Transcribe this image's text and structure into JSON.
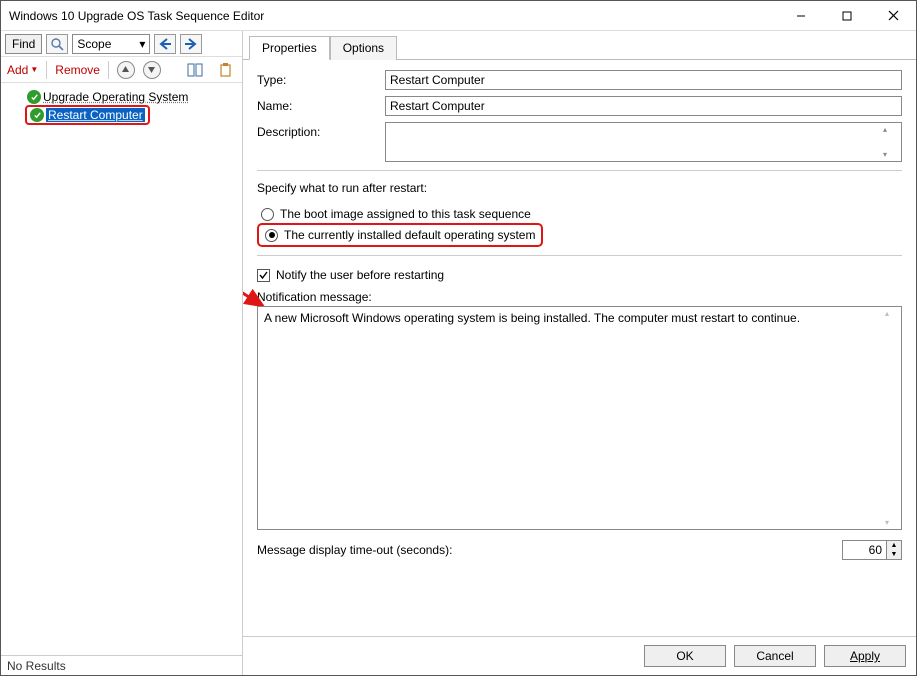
{
  "window": {
    "title": "Windows 10 Upgrade OS Task Sequence Editor"
  },
  "toolbar": {
    "find": "Find",
    "scope": "Scope",
    "add": "Add",
    "remove": "Remove"
  },
  "tree": {
    "items": [
      {
        "label": "Upgrade Operating System",
        "selected": false
      },
      {
        "label": "Restart Computer",
        "selected": true
      }
    ]
  },
  "statusbar": {
    "text": "No Results"
  },
  "tabs": {
    "properties": "Properties",
    "options": "Options"
  },
  "props": {
    "type_label": "Type:",
    "type_value": "Restart Computer",
    "name_label": "Name:",
    "name_value": "Restart Computer",
    "desc_label": "Description:",
    "desc_value": "",
    "specify_label": "Specify what to run after restart:",
    "radio_boot": "The boot image assigned to this task sequence",
    "radio_os": "The currently installed default operating system",
    "notify": "Notify the user before restarting",
    "notify_checked": true,
    "notif_label": "Notification message:",
    "notif_value": "A new Microsoft Windows operating system is being installed. The computer must restart to continue.",
    "timeout_label": "Message display time-out (seconds):",
    "timeout_value": "60"
  },
  "footer": {
    "ok": "OK",
    "cancel": "Cancel",
    "apply": "Apply"
  }
}
